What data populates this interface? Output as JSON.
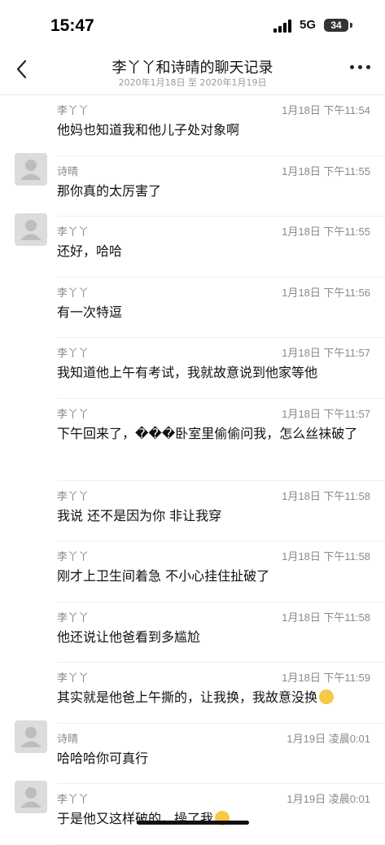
{
  "status": {
    "time": "15:47",
    "network": "5G",
    "battery": "34"
  },
  "nav": {
    "title": "李丫丫和诗晴的聊天记录",
    "subtitle": "2020年1月18日 至 2020年1月19日"
  },
  "messages": [
    {
      "sender": "李丫丫",
      "time": "1月18日 下午11:54",
      "text": "他妈也知道我和他儿子处对象啊",
      "avatar": false
    },
    {
      "sender": "诗晴",
      "time": "1月18日 下午11:55",
      "text": "那你真的太厉害了",
      "avatar": true
    },
    {
      "sender": "李丫丫",
      "time": "1月18日 下午11:55",
      "text": "还好，哈哈",
      "avatar": true
    },
    {
      "sender": "李丫丫",
      "time": "1月18日 下午11:56",
      "text": "有一次特逗",
      "avatar": false
    },
    {
      "sender": "李丫丫",
      "time": "1月18日 下午11:57",
      "text": "我知道他上午有考试，我就故意说到他家等他",
      "avatar": false
    },
    {
      "sender": "李丫丫",
      "time": "1月18日 下午11:57",
      "text": "下午回来了，���卧室里偷偷问我，怎么丝袜破了",
      "avatar": false
    },
    {
      "sender": "李丫丫",
      "time": "1月18日 下午11:58",
      "text": "我说 还不是因为你 非让我穿",
      "avatar": false
    },
    {
      "sender": "李丫丫",
      "time": "1月18日 下午11:58",
      "text": "刚才上卫生间着急 不小心挂住扯破了",
      "avatar": false
    },
    {
      "sender": "李丫丫",
      "time": "1月18日 下午11:58",
      "text": "他还说让他爸看到多尴尬",
      "avatar": false
    },
    {
      "sender": "李丫丫",
      "time": "1月18日 下午11:59",
      "text": "其实就是他爸上午撕的，让我换，我故意没换",
      "avatar": false,
      "emoji": "thinking-face-emoji"
    },
    {
      "sender": "诗晴",
      "time": "1月19日 凌晨0:01",
      "text": "哈哈哈你可真行",
      "avatar": true
    },
    {
      "sender": "李丫丫",
      "time": "1月19日 凌晨0:01",
      "text": "于是他又这样破的，操了我",
      "avatar": true,
      "emoji": "blushing-face-emoji"
    }
  ],
  "icons": {
    "back": "chevron-left-icon",
    "more": "more-dots-icon",
    "avatar": "default-avatar-icon"
  }
}
